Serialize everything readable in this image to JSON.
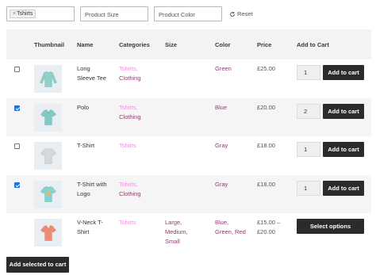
{
  "filters": {
    "category_chip": "Tshirts",
    "category_chip_remove": "×",
    "size_placeholder": "Product Size",
    "color_placeholder": "Product Color",
    "reset_label": "Reset"
  },
  "table": {
    "headers": {
      "thumbnail": "Thumbnail",
      "name": "Name",
      "categories": "Categories",
      "size": "Size",
      "color": "Color",
      "price": "Price",
      "add_to_cart": "Add to Cart"
    },
    "rows": [
      {
        "checked": false,
        "name_line1": "Long",
        "name_line2": "Sleeve Tee",
        "cat1": "Tshirts,",
        "cat2": "Clothing",
        "size": "",
        "color": "Green",
        "price": "£25.00",
        "qty": "1",
        "button": "Add to cart",
        "thumb_icon": "long-sleeve-tee-icon",
        "thumb_color": "#8fd0c8"
      },
      {
        "checked": true,
        "name_line1": "Polo",
        "name_line2": "",
        "cat1": "Tshirts,",
        "cat2": "Clothing",
        "size": "",
        "color": "Blue",
        "price": "£20.00",
        "qty": "2",
        "button": "Add to cart",
        "thumb_icon": "polo-shirt-icon",
        "thumb_color": "#7fcac4"
      },
      {
        "checked": false,
        "name_line1": "T-Shirt",
        "name_line2": "",
        "cat1": "Tshirts",
        "cat2": "",
        "size": "",
        "color": "Gray",
        "price": "£18.00",
        "qty": "1",
        "button": "Add to cart",
        "thumb_icon": "t-shirt-icon",
        "thumb_color": "#d6d8da"
      },
      {
        "checked": true,
        "name_line1": "T-Shirt with",
        "name_line2": "Logo",
        "cat1": "Tshirts,",
        "cat2": "Clothing",
        "size": "",
        "color": "Gray",
        "price": "£18.00",
        "qty": "1",
        "button": "Add to cart",
        "thumb_icon": "t-shirt-logo-icon",
        "thumb_color": "#86d2cc"
      },
      {
        "checked": false,
        "name_line1": "V-Neck T-",
        "name_line2": "Shirt",
        "cat1": "Tshirts",
        "cat2": "",
        "size_line1": "Large,",
        "size_line2": "Medium,",
        "size_line3": "Small",
        "color_line1": "Blue,",
        "color_line2": "Green, Red",
        "price_line1": "£15.00 –",
        "price_line2": "£20.00",
        "button": "Select options",
        "thumb_icon": "v-neck-shirt-icon",
        "thumb_color": "#f08a74"
      }
    ]
  },
  "bottom": {
    "add_selected_label": "Add selected to cart"
  }
}
